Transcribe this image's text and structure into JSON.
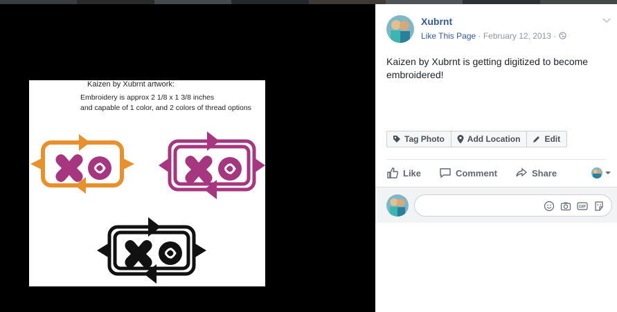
{
  "artwork": {
    "title": "Kaizen by Xubrnt artwork:",
    "line1": "Embroidery is approx 2 1/8 x 1 3/8 inches",
    "line2": "and capable of 1 color, and 2 colors of thread options",
    "colors": {
      "orange": "#e8912c",
      "magenta": "#a5367f",
      "black": "#111111"
    }
  },
  "post": {
    "author": "Xubrnt",
    "like_page": "Like This Page",
    "separator": " · ",
    "date": "February 12, 2013",
    "separator2": " · ",
    "text": "Kaizen by Xubrnt is getting digitized to become embroidered!"
  },
  "photo_tools": {
    "tag_photo": "Tag Photo",
    "add_location": "Add Location",
    "edit": "Edit"
  },
  "actions": {
    "like": "Like",
    "comment": "Comment",
    "share": "Share"
  },
  "icons": {
    "globe": "globe-icon",
    "chevron": "chevron-down-icon",
    "tag": "tag-icon",
    "location": "location-pin-icon",
    "edit": "pencil-icon",
    "like": "thumbs-up-icon",
    "comment": "speech-bubble-icon",
    "share": "share-arrow-icon",
    "emoji": "emoji-icon",
    "camera": "camera-icon",
    "gif": "gif-icon",
    "sticker": "sticker-icon"
  },
  "colors": {
    "link": "#365899",
    "meta": "#90949c",
    "text": "#1d2129"
  }
}
